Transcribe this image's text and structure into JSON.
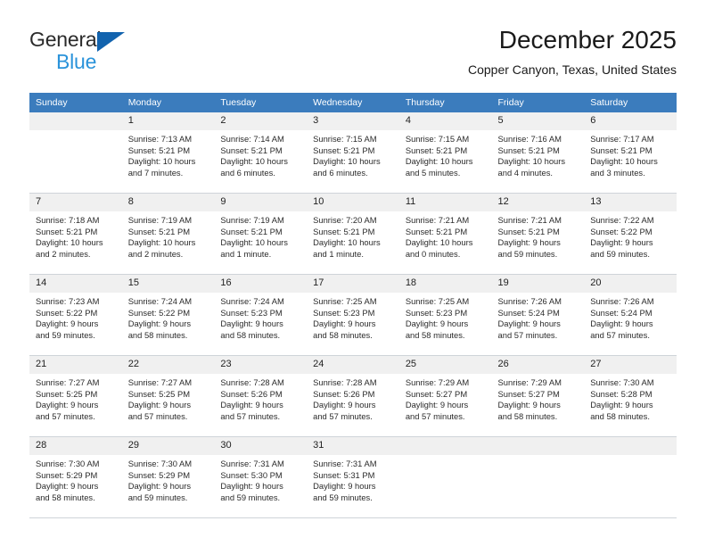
{
  "brand": {
    "name_line1": "General",
    "name_line2": "Blue",
    "logo_triangle_color": "#1263ae",
    "blue_text_color": "#2a93da"
  },
  "header": {
    "title": "December 2025",
    "subtitle": "Copper Canyon, Texas, United States",
    "header_bg_color": "#3b7cbd",
    "header_text_color": "#ffffff",
    "daynum_bg_color": "#f0f0f0"
  },
  "calendar": {
    "weekday_headers": [
      "Sunday",
      "Monday",
      "Tuesday",
      "Wednesday",
      "Thursday",
      "Friday",
      "Saturday"
    ],
    "weeks": [
      [
        {
          "day": "",
          "empty": true,
          "sunrise": "",
          "sunset": "",
          "daylight_line1": "",
          "daylight_line2": ""
        },
        {
          "day": "1",
          "sunrise": "Sunrise: 7:13 AM",
          "sunset": "Sunset: 5:21 PM",
          "daylight_line1": "Daylight: 10 hours",
          "daylight_line2": "and 7 minutes."
        },
        {
          "day": "2",
          "sunrise": "Sunrise: 7:14 AM",
          "sunset": "Sunset: 5:21 PM",
          "daylight_line1": "Daylight: 10 hours",
          "daylight_line2": "and 6 minutes."
        },
        {
          "day": "3",
          "sunrise": "Sunrise: 7:15 AM",
          "sunset": "Sunset: 5:21 PM",
          "daylight_line1": "Daylight: 10 hours",
          "daylight_line2": "and 6 minutes."
        },
        {
          "day": "4",
          "sunrise": "Sunrise: 7:15 AM",
          "sunset": "Sunset: 5:21 PM",
          "daylight_line1": "Daylight: 10 hours",
          "daylight_line2": "and 5 minutes."
        },
        {
          "day": "5",
          "sunrise": "Sunrise: 7:16 AM",
          "sunset": "Sunset: 5:21 PM",
          "daylight_line1": "Daylight: 10 hours",
          "daylight_line2": "and 4 minutes."
        },
        {
          "day": "6",
          "sunrise": "Sunrise: 7:17 AM",
          "sunset": "Sunset: 5:21 PM",
          "daylight_line1": "Daylight: 10 hours",
          "daylight_line2": "and 3 minutes."
        }
      ],
      [
        {
          "day": "7",
          "sunrise": "Sunrise: 7:18 AM",
          "sunset": "Sunset: 5:21 PM",
          "daylight_line1": "Daylight: 10 hours",
          "daylight_line2": "and 2 minutes."
        },
        {
          "day": "8",
          "sunrise": "Sunrise: 7:19 AM",
          "sunset": "Sunset: 5:21 PM",
          "daylight_line1": "Daylight: 10 hours",
          "daylight_line2": "and 2 minutes."
        },
        {
          "day": "9",
          "sunrise": "Sunrise: 7:19 AM",
          "sunset": "Sunset: 5:21 PM",
          "daylight_line1": "Daylight: 10 hours",
          "daylight_line2": "and 1 minute."
        },
        {
          "day": "10",
          "sunrise": "Sunrise: 7:20 AM",
          "sunset": "Sunset: 5:21 PM",
          "daylight_line1": "Daylight: 10 hours",
          "daylight_line2": "and 1 minute."
        },
        {
          "day": "11",
          "sunrise": "Sunrise: 7:21 AM",
          "sunset": "Sunset: 5:21 PM",
          "daylight_line1": "Daylight: 10 hours",
          "daylight_line2": "and 0 minutes."
        },
        {
          "day": "12",
          "sunrise": "Sunrise: 7:21 AM",
          "sunset": "Sunset: 5:21 PM",
          "daylight_line1": "Daylight: 9 hours",
          "daylight_line2": "and 59 minutes."
        },
        {
          "day": "13",
          "sunrise": "Sunrise: 7:22 AM",
          "sunset": "Sunset: 5:22 PM",
          "daylight_line1": "Daylight: 9 hours",
          "daylight_line2": "and 59 minutes."
        }
      ],
      [
        {
          "day": "14",
          "sunrise": "Sunrise: 7:23 AM",
          "sunset": "Sunset: 5:22 PM",
          "daylight_line1": "Daylight: 9 hours",
          "daylight_line2": "and 59 minutes."
        },
        {
          "day": "15",
          "sunrise": "Sunrise: 7:24 AM",
          "sunset": "Sunset: 5:22 PM",
          "daylight_line1": "Daylight: 9 hours",
          "daylight_line2": "and 58 minutes."
        },
        {
          "day": "16",
          "sunrise": "Sunrise: 7:24 AM",
          "sunset": "Sunset: 5:23 PM",
          "daylight_line1": "Daylight: 9 hours",
          "daylight_line2": "and 58 minutes."
        },
        {
          "day": "17",
          "sunrise": "Sunrise: 7:25 AM",
          "sunset": "Sunset: 5:23 PM",
          "daylight_line1": "Daylight: 9 hours",
          "daylight_line2": "and 58 minutes."
        },
        {
          "day": "18",
          "sunrise": "Sunrise: 7:25 AM",
          "sunset": "Sunset: 5:23 PM",
          "daylight_line1": "Daylight: 9 hours",
          "daylight_line2": "and 58 minutes."
        },
        {
          "day": "19",
          "sunrise": "Sunrise: 7:26 AM",
          "sunset": "Sunset: 5:24 PM",
          "daylight_line1": "Daylight: 9 hours",
          "daylight_line2": "and 57 minutes."
        },
        {
          "day": "20",
          "sunrise": "Sunrise: 7:26 AM",
          "sunset": "Sunset: 5:24 PM",
          "daylight_line1": "Daylight: 9 hours",
          "daylight_line2": "and 57 minutes."
        }
      ],
      [
        {
          "day": "21",
          "sunrise": "Sunrise: 7:27 AM",
          "sunset": "Sunset: 5:25 PM",
          "daylight_line1": "Daylight: 9 hours",
          "daylight_line2": "and 57 minutes."
        },
        {
          "day": "22",
          "sunrise": "Sunrise: 7:27 AM",
          "sunset": "Sunset: 5:25 PM",
          "daylight_line1": "Daylight: 9 hours",
          "daylight_line2": "and 57 minutes."
        },
        {
          "day": "23",
          "sunrise": "Sunrise: 7:28 AM",
          "sunset": "Sunset: 5:26 PM",
          "daylight_line1": "Daylight: 9 hours",
          "daylight_line2": "and 57 minutes."
        },
        {
          "day": "24",
          "sunrise": "Sunrise: 7:28 AM",
          "sunset": "Sunset: 5:26 PM",
          "daylight_line1": "Daylight: 9 hours",
          "daylight_line2": "and 57 minutes."
        },
        {
          "day": "25",
          "sunrise": "Sunrise: 7:29 AM",
          "sunset": "Sunset: 5:27 PM",
          "daylight_line1": "Daylight: 9 hours",
          "daylight_line2": "and 57 minutes."
        },
        {
          "day": "26",
          "sunrise": "Sunrise: 7:29 AM",
          "sunset": "Sunset: 5:27 PM",
          "daylight_line1": "Daylight: 9 hours",
          "daylight_line2": "and 58 minutes."
        },
        {
          "day": "27",
          "sunrise": "Sunrise: 7:30 AM",
          "sunset": "Sunset: 5:28 PM",
          "daylight_line1": "Daylight: 9 hours",
          "daylight_line2": "and 58 minutes."
        }
      ],
      [
        {
          "day": "28",
          "sunrise": "Sunrise: 7:30 AM",
          "sunset": "Sunset: 5:29 PM",
          "daylight_line1": "Daylight: 9 hours",
          "daylight_line2": "and 58 minutes."
        },
        {
          "day": "29",
          "sunrise": "Sunrise: 7:30 AM",
          "sunset": "Sunset: 5:29 PM",
          "daylight_line1": "Daylight: 9 hours",
          "daylight_line2": "and 59 minutes."
        },
        {
          "day": "30",
          "sunrise": "Sunrise: 7:31 AM",
          "sunset": "Sunset: 5:30 PM",
          "daylight_line1": "Daylight: 9 hours",
          "daylight_line2": "and 59 minutes."
        },
        {
          "day": "31",
          "sunrise": "Sunrise: 7:31 AM",
          "sunset": "Sunset: 5:31 PM",
          "daylight_line1": "Daylight: 9 hours",
          "daylight_line2": "and 59 minutes."
        },
        {
          "day": "",
          "empty": true,
          "sunrise": "",
          "sunset": "",
          "daylight_line1": "",
          "daylight_line2": ""
        },
        {
          "day": "",
          "empty": true,
          "sunrise": "",
          "sunset": "",
          "daylight_line1": "",
          "daylight_line2": ""
        },
        {
          "day": "",
          "empty": true,
          "sunrise": "",
          "sunset": "",
          "daylight_line1": "",
          "daylight_line2": ""
        }
      ]
    ]
  }
}
